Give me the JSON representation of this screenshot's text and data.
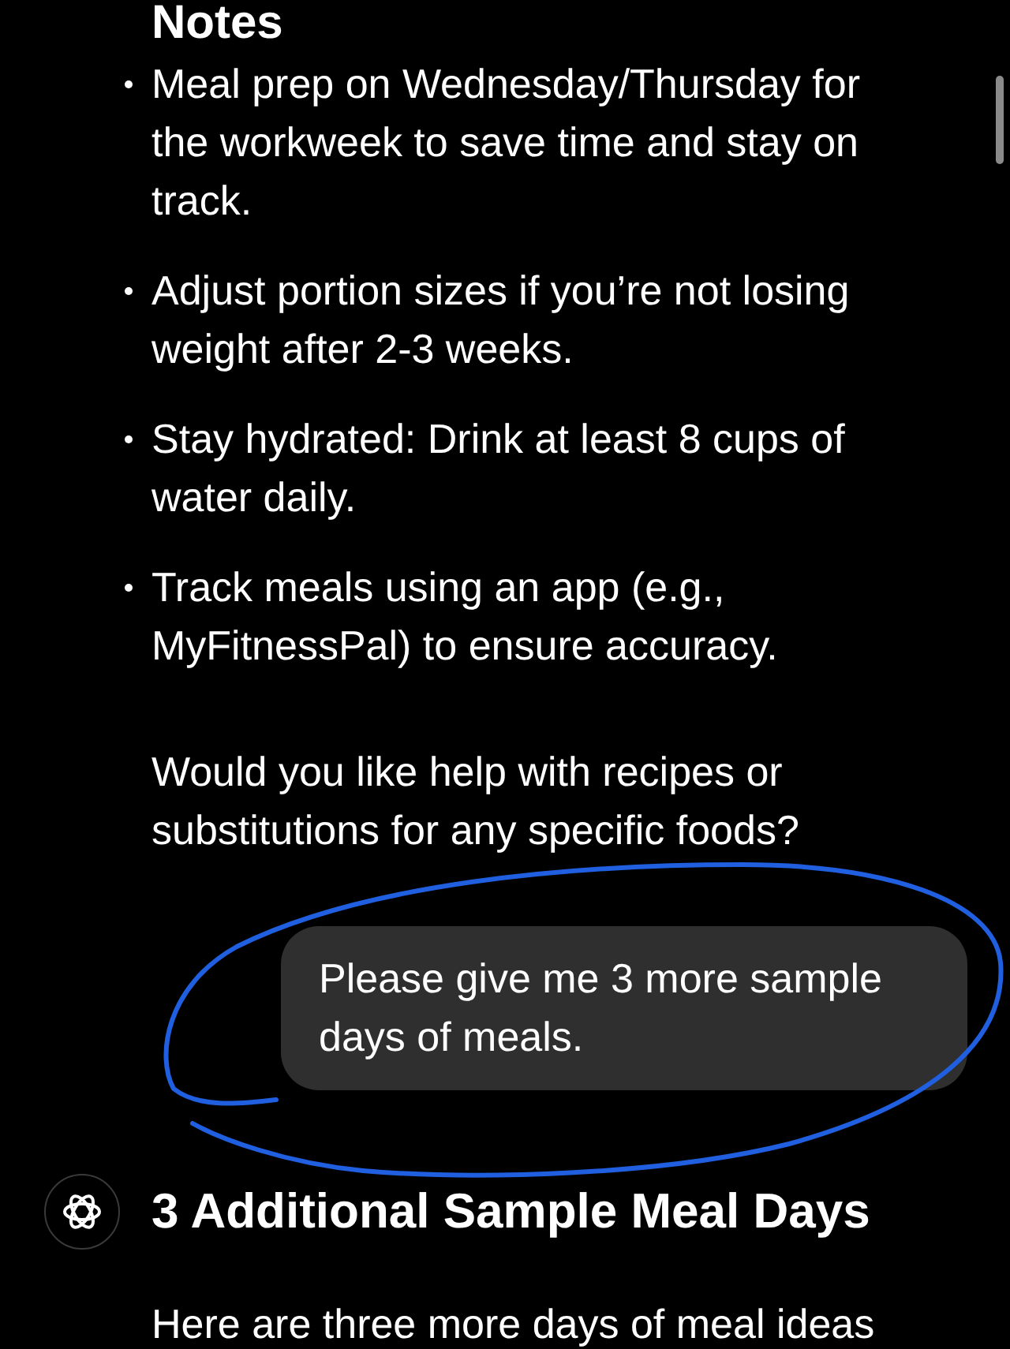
{
  "notes": {
    "heading": "Notes",
    "bullets": [
      "Meal prep on Wednesday/Thursday for the workweek to save time and stay on track.",
      "Adjust portion sizes if you’re not losing weight after 2-3 weeks.",
      "Stay hydrated: Drink at least 8 cups of water daily.",
      "Track meals using an app (e.g., MyFitnessPal) to ensure accuracy."
    ]
  },
  "question": "Would you like help with recipes or substitutions for any specific foods?",
  "user_message": "Please give me 3 more sample days of meals.",
  "reply": {
    "heading": "3 Additional Sample Meal Days",
    "intro": "Here are three more days of meal ideas"
  }
}
